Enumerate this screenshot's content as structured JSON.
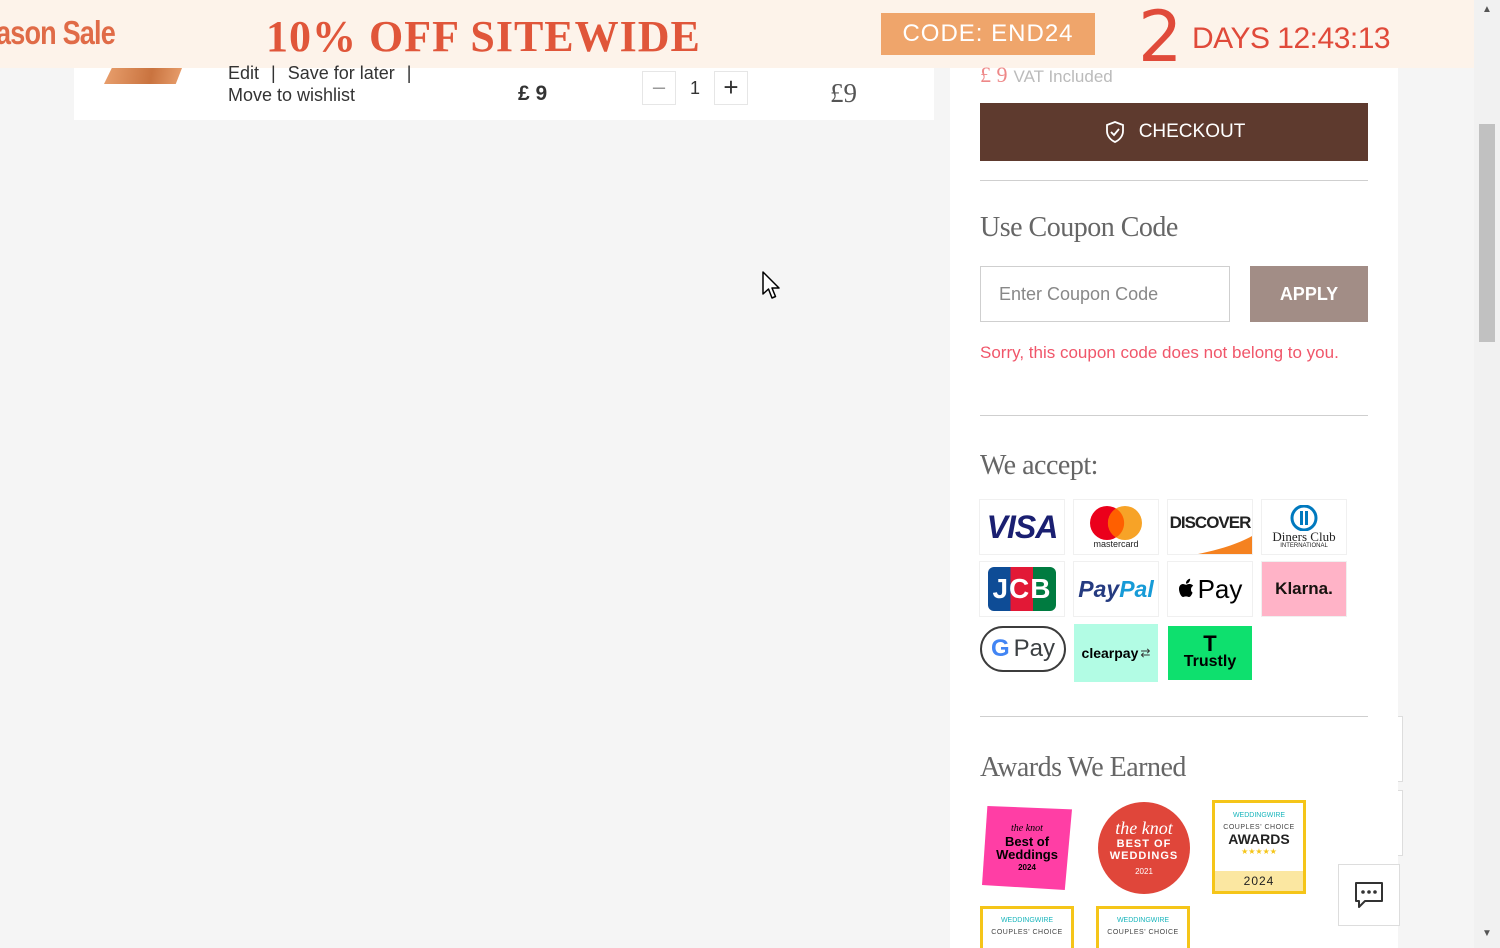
{
  "banner": {
    "season_text": "ason Sale",
    "headline": "10% OFF SITEWIDE",
    "code_label": "CODE: END24",
    "days_number": "2",
    "days_text": "DAYS 12:43:13"
  },
  "cart_item": {
    "links": {
      "edit": "Edit",
      "separator": "|",
      "save_for_later": "Save for later",
      "move_to_wishlist": "Move to wishlist"
    },
    "unit_price": "£ 9",
    "quantity": "1",
    "qty_minus": "–",
    "qty_plus": "+",
    "line_total": "£9"
  },
  "summary": {
    "vat_pound": "£ 9",
    "vat_text": "VAT Included",
    "checkout_label": "CHECKOUT",
    "coupon": {
      "title": "Use Coupon Code",
      "placeholder": "Enter Coupon Code",
      "apply_label": "APPLY",
      "error": "Sorry, this coupon code does not belong to you."
    },
    "payments": {
      "title": "We accept:",
      "methods": {
        "visa": "VISA",
        "mastercard": "mastercard",
        "discover": "DISCOVER",
        "diners": "Diners Club",
        "diners_sub": "INTERNATIONAL",
        "jcb": "JCB",
        "paypal_a": "Pay",
        "paypal_b": "Pal",
        "applepay": "Pay",
        "klarna": "Klarna.",
        "gpay": "Pay",
        "clearpay": "clearpay",
        "trustly": "Trustly"
      }
    },
    "awards": {
      "title": "Awards We Earned",
      "knot1": {
        "brand": "the knot",
        "line1": "Best of",
        "line2": "Weddings",
        "year": "2024"
      },
      "knot2": {
        "brand": "the knot",
        "line1": "BEST OF",
        "line2": "WEDDINGS",
        "year": "2021"
      },
      "ww1": {
        "brand": "WEDDINGWIRE",
        "line1": "COUPLES' CHOICE",
        "line2": "AWARDS",
        "stars": "★★★★★",
        "year": "2024"
      },
      "ww2": {
        "brand": "WEDDINGWIRE",
        "line1": "COUPLES' CHOICE"
      },
      "ww3": {
        "brand": "WEDDINGWIRE",
        "line1": "COUPLES' CHOICE"
      }
    }
  },
  "colors": {
    "banner_bg": "#fdf3ea",
    "banner_red": "#e0563a",
    "code_orange": "#efa56b",
    "checkout_brown": "#5e3a2e",
    "apply_taupe": "#a28d86",
    "error_pink": "#f0566a"
  },
  "icons": {
    "checkout": "shield-check-icon",
    "chat": "chat-bubble-icon",
    "cursor": "mouse-pointer-icon"
  }
}
